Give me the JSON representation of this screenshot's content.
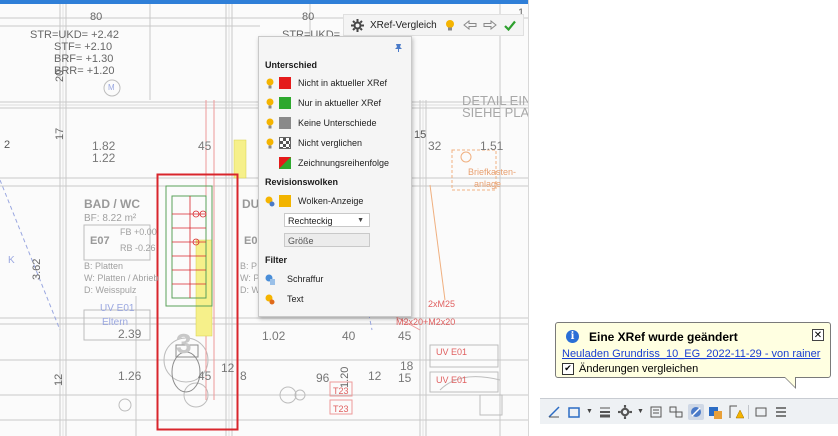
{
  "drawing": {
    "dims": {
      "d80a": "80",
      "d80b": "80",
      "str_ukd": "STR=UKD= +2.42",
      "stf": "STF= +2.10",
      "brf": "BRF= +1.30",
      "brr": "BRR= +1.20",
      "str_ukd2": "STR=UKD= +2.4",
      "d20": "20",
      "d17": "17",
      "d182": "1.82",
      "d122": "1.22",
      "d45": "45",
      "d15": "15",
      "d32": "32",
      "d151": "1.51",
      "d2": "2",
      "d362": "3.62",
      "d239": "2.39",
      "d102": "1.02",
      "d40": "40",
      "d45b": "45",
      "d126": "1.26",
      "d45c": "45",
      "d12": "12",
      "d8": "8",
      "d96": "96",
      "d120": "1.20",
      "d12b": "12",
      "d18": "18",
      "d15b": "15",
      "d12c": "12",
      "d1": "1"
    },
    "detail_text": "DETAIL EIN",
    "detail_text2": "SIEHE PLA",
    "bad_wc": "BAD / WC",
    "bf": "BF: 8.22 m²",
    "fb": "FB +0.00",
    "rb": "RB -0.26",
    "e07": "E07",
    "b_platten": "B: Platten",
    "w_platten": "W: Platten / Abrieb",
    "d_weisspulz": "D: Weisspulz",
    "uv_e01": "UV E01",
    "eltern": "Eltern",
    "du": "DU",
    "e0": "E0",
    "b_p": "B: P",
    "w_p": "W: P",
    "d_w": "D: W",
    "uv_e01b": "UV E01",
    "uv_e01c": "UV E01",
    "briefkasten": "Briefkasten-",
    "anlage": "anlage",
    "m25": "2xM25",
    "m20": "M2x20+M2x20",
    "t23": "T23",
    "t23b": "T23",
    "m": "M",
    "k": "K",
    "three": "3"
  },
  "xref_toolbar": {
    "label": "XRef-Vergleich",
    "settings_icon": "gear-icon",
    "bulb_icon": "lightbulb-icon",
    "prev_icon": "arrow-left-icon",
    "next_icon": "arrow-right-icon",
    "accept_icon": "checkmark-icon"
  },
  "panel": {
    "section_diff": "Unterschied",
    "diff_items": [
      {
        "label": "Nicht in aktueller XRef",
        "color": "#e41b1b"
      },
      {
        "label": "Nur in aktueller XRef",
        "color": "#2ea82e"
      },
      {
        "label": "Keine Unterschiede",
        "color": "#8a8a8a"
      },
      {
        "label": "Nicht verglichen",
        "color": "checker"
      },
      {
        "label": "Zeichnungsreihenfolge",
        "color": "split"
      }
    ],
    "section_clouds": "Revisionswolken",
    "cloud_label": "Wolken-Anzeige",
    "cloud_color": "#f2b400",
    "shape_value": "Rechteckig",
    "size_placeholder": "Größe",
    "section_filter": "Filter",
    "filter_hatch": "Schraffur",
    "filter_text": "Text"
  },
  "notification": {
    "title": "Eine XRef wurde geändert",
    "link": "Neuladen Grundriss_10_EG_2022-11-29 - von rainer",
    "checkbox_label": "Änderungen vergleichen",
    "checked": true
  },
  "colors": {
    "accent_red": "#d9262c",
    "accent_yellow": "#f6f08a",
    "link_blue": "#1a3fd1"
  }
}
